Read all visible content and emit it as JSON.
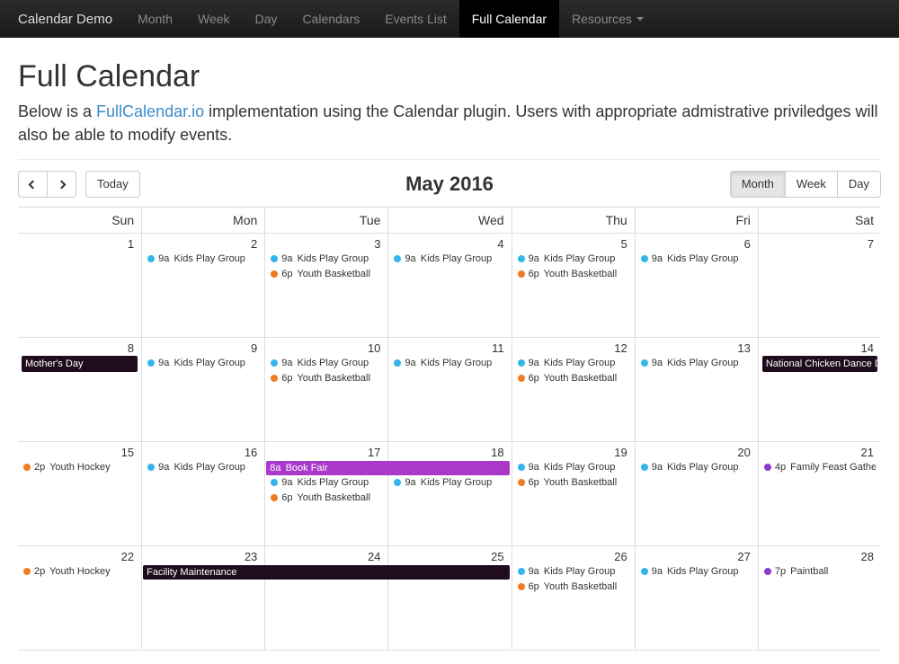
{
  "navbar": {
    "brand": "Calendar Demo",
    "items": [
      {
        "label": "Month",
        "active": false
      },
      {
        "label": "Week",
        "active": false
      },
      {
        "label": "Day",
        "active": false
      },
      {
        "label": "Calendars",
        "active": false
      },
      {
        "label": "Events List",
        "active": false
      },
      {
        "label": "Full Calendar",
        "active": true
      }
    ],
    "resources_label": "Resources"
  },
  "page": {
    "title": "Full Calendar",
    "intro_pre": "Below is a ",
    "intro_link": "FullCalendar.io",
    "intro_post": " implementation using the Calendar plugin. Users with appropriate admistrative priviledges will also be able to modify events."
  },
  "toolbar": {
    "today_label": "Today",
    "title": "May 2016",
    "views": [
      {
        "label": "Month",
        "active": true
      },
      {
        "label": "Week",
        "active": false
      },
      {
        "label": "Day",
        "active": false
      }
    ]
  },
  "colors": {
    "blue": "#36b5ea",
    "orange": "#f07b22",
    "purple": "#aa39c9",
    "violet": "#8f3ac9",
    "dark": "#1f0c1c"
  },
  "dow": [
    "Sun",
    "Mon",
    "Tue",
    "Wed",
    "Thu",
    "Fri",
    "Sat"
  ],
  "weeks": [
    {
      "days": [
        {
          "num": 1,
          "events": []
        },
        {
          "num": 2,
          "events": [
            {
              "time": "9a",
              "title": "Kids Play Group",
              "color": "blue"
            }
          ]
        },
        {
          "num": 3,
          "events": [
            {
              "time": "9a",
              "title": "Kids Play Group",
              "color": "blue"
            },
            {
              "time": "6p",
              "title": "Youth Basketball",
              "color": "orange"
            }
          ]
        },
        {
          "num": 4,
          "events": [
            {
              "time": "9a",
              "title": "Kids Play Group",
              "color": "blue"
            }
          ]
        },
        {
          "num": 5,
          "events": [
            {
              "time": "9a",
              "title": "Kids Play Group",
              "color": "blue"
            },
            {
              "time": "6p",
              "title": "Youth Basketball",
              "color": "orange"
            }
          ]
        },
        {
          "num": 6,
          "events": [
            {
              "time": "9a",
              "title": "Kids Play Group",
              "color": "blue"
            }
          ]
        },
        {
          "num": 7,
          "events": []
        }
      ],
      "multiday": []
    },
    {
      "days": [
        {
          "num": 8,
          "events": [
            {
              "block": true,
              "title": "Mother's Day",
              "color": "dark"
            }
          ]
        },
        {
          "num": 9,
          "events": [
            {
              "time": "9a",
              "title": "Kids Play Group",
              "color": "blue"
            }
          ]
        },
        {
          "num": 10,
          "events": [
            {
              "time": "9a",
              "title": "Kids Play Group",
              "color": "blue"
            },
            {
              "time": "6p",
              "title": "Youth Basketball",
              "color": "orange"
            }
          ]
        },
        {
          "num": 11,
          "events": [
            {
              "time": "9a",
              "title": "Kids Play Group",
              "color": "blue"
            }
          ]
        },
        {
          "num": 12,
          "events": [
            {
              "time": "9a",
              "title": "Kids Play Group",
              "color": "blue"
            },
            {
              "time": "6p",
              "title": "Youth Basketball",
              "color": "orange"
            }
          ]
        },
        {
          "num": 13,
          "events": [
            {
              "time": "9a",
              "title": "Kids Play Group",
              "color": "blue"
            }
          ]
        },
        {
          "num": 14,
          "events": [
            {
              "block": true,
              "title": "National Chicken Dance Da",
              "color": "dark"
            }
          ]
        }
      ],
      "multiday": []
    },
    {
      "days": [
        {
          "num": 15,
          "events": [
            {
              "time": "2p",
              "title": "Youth Hockey",
              "color": "orange"
            }
          ]
        },
        {
          "num": 16,
          "events": [
            {
              "time": "9a",
              "title": "Kids Play Group",
              "color": "blue"
            }
          ]
        },
        {
          "num": 17,
          "events": [
            {
              "spacer": true
            },
            {
              "time": "9a",
              "title": "Kids Play Group",
              "color": "blue"
            },
            {
              "time": "6p",
              "title": "Youth Basketball",
              "color": "orange"
            }
          ]
        },
        {
          "num": 18,
          "events": [
            {
              "spacer": true
            },
            {
              "time": "9a",
              "title": "Kids Play Group",
              "color": "blue"
            }
          ]
        },
        {
          "num": 19,
          "events": [
            {
              "time": "9a",
              "title": "Kids Play Group",
              "color": "blue"
            },
            {
              "time": "6p",
              "title": "Youth Basketball",
              "color": "orange"
            }
          ]
        },
        {
          "num": 20,
          "events": [
            {
              "time": "9a",
              "title": "Kids Play Group",
              "color": "blue"
            }
          ]
        },
        {
          "num": 21,
          "events": [
            {
              "time": "4p",
              "title": "Family Feast Gathering",
              "color": "violet"
            }
          ]
        }
      ],
      "multiday": [
        {
          "startCol": 2,
          "span": 2,
          "time": "8a",
          "title": "Book Fair",
          "color": "purple"
        }
      ]
    },
    {
      "days": [
        {
          "num": 22,
          "events": [
            {
              "time": "2p",
              "title": "Youth Hockey",
              "color": "orange"
            }
          ]
        },
        {
          "num": 23,
          "events": [
            {
              "spacer": true
            }
          ]
        },
        {
          "num": 24,
          "events": [
            {
              "spacer": true
            }
          ]
        },
        {
          "num": 25,
          "events": [
            {
              "spacer": true
            }
          ]
        },
        {
          "num": 26,
          "events": [
            {
              "time": "9a",
              "title": "Kids Play Group",
              "color": "blue"
            },
            {
              "time": "6p",
              "title": "Youth Basketball",
              "color": "orange"
            }
          ]
        },
        {
          "num": 27,
          "events": [
            {
              "time": "9a",
              "title": "Kids Play Group",
              "color": "blue"
            }
          ]
        },
        {
          "num": 28,
          "events": [
            {
              "time": "7p",
              "title": "Paintball",
              "color": "violet"
            }
          ]
        }
      ],
      "multiday": [
        {
          "startCol": 1,
          "span": 3,
          "title": "Facility Maintenance",
          "color": "dark"
        }
      ]
    }
  ]
}
